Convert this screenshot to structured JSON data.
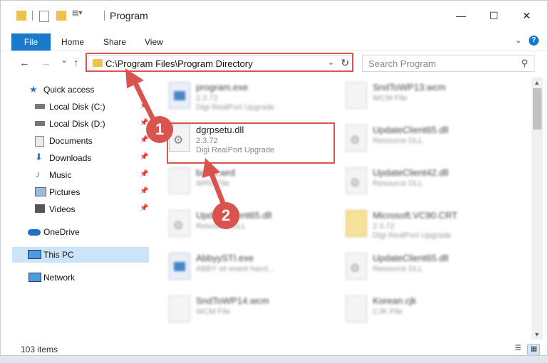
{
  "window": {
    "title": "Program",
    "controls": {
      "minimize": "—",
      "maximize": "☐",
      "close": "✕"
    }
  },
  "ribbon": {
    "tabs": [
      "File",
      "Home",
      "Share",
      "View"
    ],
    "help": "?"
  },
  "navigation": {
    "back": "←",
    "forward": "→",
    "recent": "⌄",
    "up": "↑",
    "address": "C:\\Program Files\\Program Directory",
    "search_placeholder": "Search Program"
  },
  "sidebar": {
    "items": [
      {
        "label": "Quick access",
        "icon": "star-icon",
        "pinned": false
      },
      {
        "label": "Local Disk (C:)",
        "icon": "drive-icon",
        "pinned": true
      },
      {
        "label": "Local Disk (D:)",
        "icon": "drive-icon",
        "pinned": true
      },
      {
        "label": "Documents",
        "icon": "documents-icon",
        "pinned": true
      },
      {
        "label": "Downloads",
        "icon": "download-icon",
        "pinned": true
      },
      {
        "label": "Music",
        "icon": "music-icon",
        "pinned": true
      },
      {
        "label": "Pictures",
        "icon": "pictures-icon",
        "pinned": true
      },
      {
        "label": "Videos",
        "icon": "videos-icon",
        "pinned": true
      },
      {
        "label": "OneDrive",
        "icon": "cloud-icon",
        "pinned": false
      },
      {
        "label": "This PC",
        "icon": "computer-icon",
        "pinned": false,
        "selected": true
      },
      {
        "label": "Network",
        "icon": "network-icon",
        "pinned": false
      }
    ]
  },
  "files": [
    {
      "name": "program.exe",
      "meta1": "2.3.72",
      "meta2": "Digi RealPort Upgrade",
      "icon": "exe"
    },
    {
      "name": "SndToWP13.wcm",
      "meta1": "WCM File",
      "meta2": "",
      "icon": "doc"
    },
    {
      "name": "dgrpsetu.dll",
      "meta1": "2.3.72",
      "meta2": "Digi RealPort Upgrade",
      "icon": "gear"
    },
    {
      "name": "UpdateClient65.dll",
      "meta1": "Resource DLL",
      "meta2": "",
      "icon": "gear"
    },
    {
      "name": "basic.wrd",
      "meta1": "WRD File",
      "meta2": "",
      "icon": "doc"
    },
    {
      "name": "UpdateClient42.dll",
      "meta1": "Resource DLL",
      "meta2": "",
      "icon": "gear"
    },
    {
      "name": "UpdateClient65.dll",
      "meta1": "Resource DLL",
      "meta2": "",
      "icon": "gear"
    },
    {
      "name": "Microsoft.VC90.CRT",
      "meta1": "2.3.72",
      "meta2": "Digi RealPort Upgrade",
      "icon": "folderz"
    },
    {
      "name": "AbbyySTI.exe",
      "meta1": "ABBY sti event hand...",
      "meta2": "",
      "icon": "exe"
    },
    {
      "name": "UpdateClient65.dll",
      "meta1": "Resource DLL",
      "meta2": "",
      "icon": "gear"
    },
    {
      "name": "SndToWP14.wcm",
      "meta1": "WCM File",
      "meta2": "",
      "icon": "doc"
    },
    {
      "name": "Korean.cjk",
      "meta1": "CJK File",
      "meta2": "",
      "icon": "doc"
    }
  ],
  "status": {
    "count": "103 items"
  },
  "annotations": {
    "badge1": "1",
    "badge2": "2"
  },
  "colors": {
    "accent": "#1979ca",
    "highlight": "#d9534f",
    "selected": "#cce4f7"
  }
}
